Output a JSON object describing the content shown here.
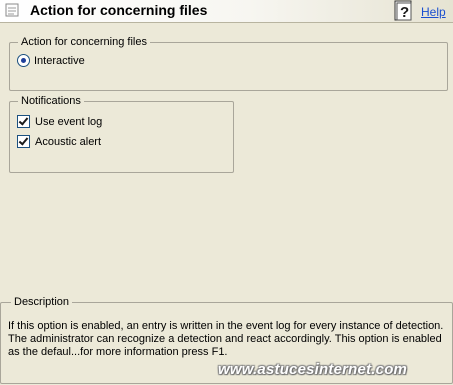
{
  "header": {
    "title": "Action for concerning files",
    "help_label": "Help"
  },
  "action_group": {
    "legend": "Action for concerning files",
    "option_label": "Interactive",
    "selected": true
  },
  "notifications_group": {
    "legend": "Notifications",
    "items": [
      {
        "label": "Use event log",
        "checked": true
      },
      {
        "label": "Acoustic alert",
        "checked": true
      }
    ]
  },
  "description": {
    "legend": "Description",
    "text": "If this option is enabled, an entry is written in the event log for every instance of detection. The administrator can recognize a detection and react accordingly. This option is enabled as the defaul...for more information press F1."
  },
  "watermark": "www.astucesinternet.com",
  "icons": {
    "header": "config-page-icon",
    "help": "help-book-icon"
  }
}
